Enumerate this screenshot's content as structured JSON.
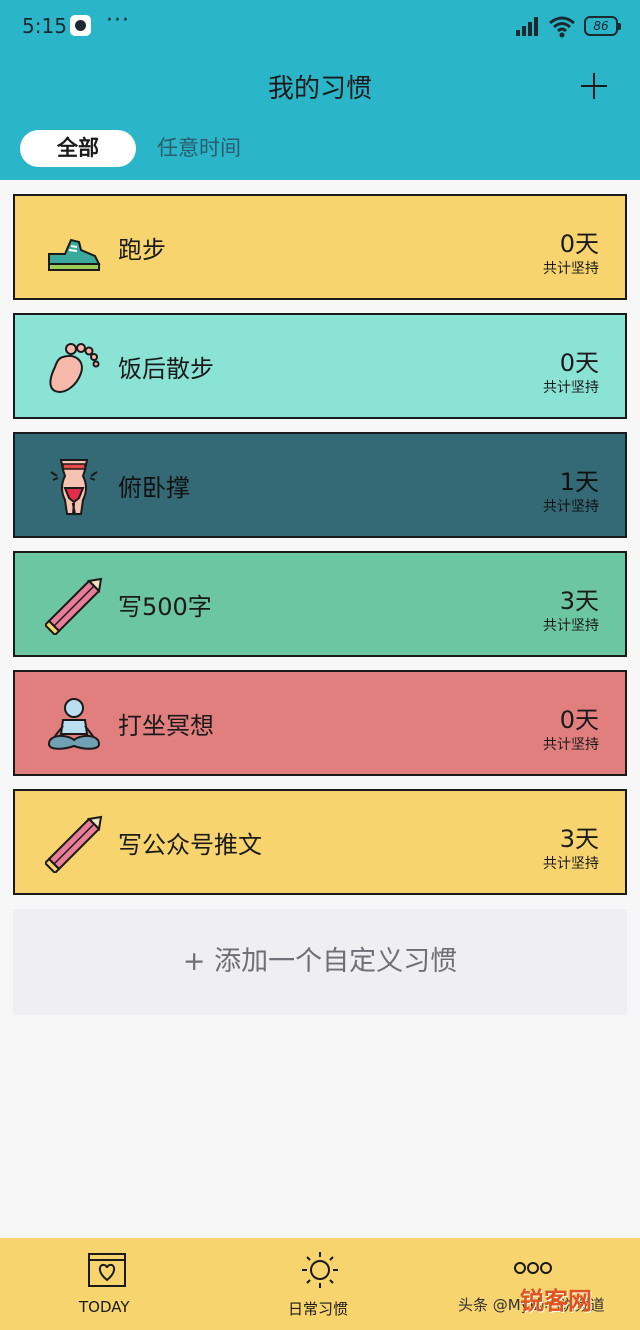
{
  "status_bar": {
    "time": "5:15",
    "more": "···",
    "battery": "86"
  },
  "header": {
    "title": "我的习惯"
  },
  "tabs": [
    {
      "label": "全部",
      "active": true
    },
    {
      "label": "任意时间",
      "active": false
    }
  ],
  "habits": [
    {
      "name": "跑步",
      "days": "0天",
      "sub": "共计坚持",
      "color": "#f7d46d",
      "icon": "sneaker-icon"
    },
    {
      "name": "饭后散步",
      "days": "0天",
      "sub": "共计坚持",
      "color": "#8be3d6",
      "icon": "footprint-icon"
    },
    {
      "name": "俯卧撑",
      "days": "1天",
      "sub": "共计坚持",
      "color": "#346a76",
      "icon": "waist-icon"
    },
    {
      "name": "写500字",
      "days": "3天",
      "sub": "共计坚持",
      "color": "#6cc6a1",
      "icon": "pencil-icon"
    },
    {
      "name": "打坐冥想",
      "days": "0天",
      "sub": "共计坚持",
      "color": "#e17e7e",
      "icon": "meditation-icon"
    },
    {
      "name": "写公众号推文",
      "days": "3天",
      "sub": "共计坚持",
      "color": "#f7d46d",
      "icon": "pencil-icon"
    }
  ],
  "add_custom": "+ 添加一个自定义习惯",
  "bottom_nav": [
    {
      "label": "TODAY",
      "icon": "calendar-heart-icon"
    },
    {
      "label": "日常习惯",
      "icon": "sun-icon"
    },
    {
      "label": "",
      "icon": "more-dots-icon"
    }
  ],
  "watermark": {
    "text": "头条 @My的小说频道",
    "brand": "锐客网"
  }
}
